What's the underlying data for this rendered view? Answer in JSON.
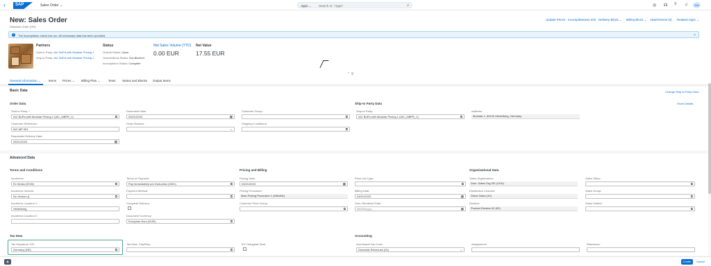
{
  "shell": {
    "app_title": "Sales Order ⌄",
    "search_scope": "Apps ⌄",
    "search_placeholder": "Search In: \"Apps\"",
    "avatar": "MM"
  },
  "header": {
    "title": "New: Sales Order",
    "subtitle": "Standard Order (OR)",
    "actions": [
      "Update Prices",
      "Incompleteness Info",
      "Delivery Block ⌄",
      "Billing Block ⌄",
      "Attachments (0)",
      "Related Apps ⌄"
    ],
    "message": "The incompletion check has run. All necessary data has been provided.",
    "partners": {
      "title": "Partners",
      "soldto_label": "Sold-to Party:",
      "soldto_value": "IAC BuPa with Modular Pricing 1",
      "shipto_label": "Ship-to Party:",
      "shipto_value": "IAC BuPa with Modular Pricing 1"
    },
    "status": {
      "title": "Status",
      "overall_label": "Overall Status:",
      "overall_value": "Open",
      "block_label": "Overall Block Status:",
      "block_value": "Not Blocked",
      "incomp_label": "Incompletion Status:",
      "incomp_value": "Complete"
    },
    "kpi1": {
      "title": "Net Sales Volume (YTD)",
      "value": "0.00 EUR"
    },
    "kpi2": {
      "title": "Net Value",
      "value": "17.55 EUR"
    }
  },
  "tabs": [
    "General Information ⌄",
    "Items",
    "Prices ⌄",
    "Billing Plan ⌄",
    "Texts",
    "Status and Blocks",
    "Output Items"
  ],
  "basic": {
    "title": "Basic Data",
    "change_link": "Change Ship-to Party Data",
    "order_data": "Order Data",
    "shipto_data": "Ship-to Party Data",
    "show_details": "Show Details",
    "soldto_label": "Sold-to Party: *",
    "soldto_value": "IAC BuPa with Modular Pricing 1 (IAC_MBPR_1)",
    "custref_label": "Customer Reference:",
    "custref_value": "IAC MP 001",
    "reqdate_label": "Requested Delivery Date:",
    "reqdate_value": "03/21/2023",
    "docdate_label": "Document Date:",
    "docdate_value": "03/21/2023",
    "reason_label": "Order Reason:",
    "custgroup_label": "Customer Group:",
    "shipcond_label": "Shipping Conditions:",
    "shipto_label": "Ship-to Party:",
    "shipto_value": "IAC BuPa with Modular Pricing 1 (IAC_MBPR_1)",
    "address_label": "Address:",
    "address_value": "Modular 1, 69120 Heidelberg, Germany"
  },
  "advanced": {
    "title": "Advanced Data",
    "terms_title": "Terms and Conditions",
    "pricing_title": "Pricing and Billing",
    "org_title": "Organizational Data",
    "tax_title": "Tax Data",
    "accounting_title": "Accounting",
    "incoterms_label": "Incoterms:",
    "incoterms_value": "Ex Works (EXW)",
    "incover_label": "Incoterms Version:",
    "incover_value": "No Version ()",
    "incoloc1_label": "Incoterms Location 1:",
    "incoloc1_value": "Heidelberg",
    "incoloc2_label": "Incoterms Location 2:",
    "pay_terms_label": "Terms of Payment:",
    "pay_terms_value": "Pay Immediately w/o Deduction (0001)",
    "pay_method_label": "Payment Method:",
    "complete_label": "Complete Delivery:",
    "doccur_label": "Document Currency:",
    "doccur_value": "European Euro (EUR)",
    "pricing_date_label": "Pricing Date:",
    "pricing_date_value": "03/21/2023",
    "pricing_proc_label": "Pricing Procedure:",
    "pricing_proc_value": "Main Pricing Procedure 1 (ZMAIN1)",
    "cust_price_label": "Customer Price Group:",
    "pricelist_label": "Price List Type:",
    "billing_date_label": "Billing Date:",
    "billing_date_value": "03/21/2023",
    "serv_date_label": "Serv. Rendered Date:",
    "serv_date_value": "MM/dd/yyyy",
    "salesorg_label": "Sales Organization:",
    "salesorg_value": "Dom. Sales Org DE (1010)",
    "distch_label": "Distribution Channel:",
    "distch_value": "Direct Sales (10)",
    "division_label": "Division:",
    "division_value": "Product Division 00 (00)",
    "salesoffice_label": "Sales Office:",
    "salesgroup_label": "Sales Group:",
    "salesdistrict_label": "Sales District:",
    "taxdep_label": "Tax Departure C/R:",
    "taxdep_value": "Germany (DE)",
    "taxdest_label": "Tax Dest. Ctry/Reg.:",
    "eutri_label": "EU Triangular Deal:",
    "acct_label": "Acct Assmt Grp Cust.:",
    "acct_value": "Domestic Revenues (01)",
    "assignment_label": "Assignment:",
    "reference_label": "Reference:"
  },
  "footer": {
    "create": "Create",
    "cancel": "Cancel"
  }
}
